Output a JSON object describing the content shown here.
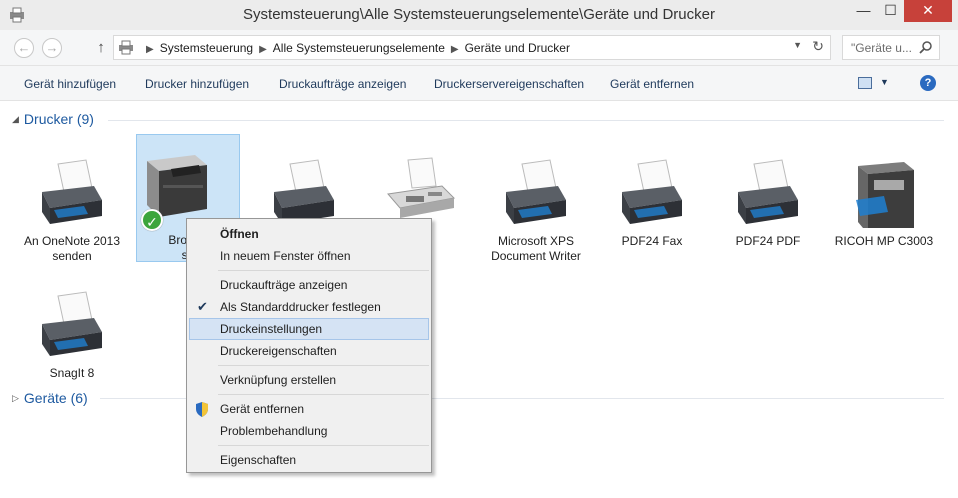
{
  "window": {
    "title": "Systemsteuerung\\Alle Systemsteuerungselemente\\Geräte und Drucker",
    "controls": {
      "minimize": "—",
      "maximize": "☐",
      "close": "✕"
    }
  },
  "address": {
    "breadcrumbs": [
      "Systemsteuerung",
      "Alle Systemsteuerungselemente",
      "Geräte und Drucker"
    ],
    "search_placeholder": "\"Geräte u..."
  },
  "commands": [
    "Gerät hinzufügen",
    "Drucker hinzufügen",
    "Druckaufträge anzeigen",
    "Druckerservereigenschaften",
    "Gerät entfernen"
  ],
  "groups": {
    "printers": {
      "header": "Drucker (9)"
    },
    "devices": {
      "header": "Geräte (6)"
    }
  },
  "printers": [
    {
      "label": "An OneNote 2013 senden",
      "icon": "printer-icon"
    },
    {
      "label": "Brother HL-5340D series",
      "icon": "laser-printer-icon",
      "default": true
    },
    {
      "label": "",
      "icon": "printer-icon"
    },
    {
      "label": "",
      "icon": "fax-icon"
    },
    {
      "label": "Microsoft XPS Document Writer",
      "icon": "printer-icon"
    },
    {
      "label": "PDF24 Fax",
      "icon": "printer-icon"
    },
    {
      "label": "PDF24 PDF",
      "icon": "printer-icon"
    },
    {
      "label": "RICOH MP C3003",
      "icon": "multifunction-printer-icon"
    },
    {
      "label": "SnagIt 8",
      "icon": "printer-icon"
    }
  ],
  "visible_labels": {
    "brother_line1": "Brother",
    "brother_line2": "se"
  },
  "context_menu": {
    "open": "Öffnen",
    "open_new_window": "In neuem Fenster öffnen",
    "show_jobs": "Druckaufträge anzeigen",
    "set_default": "Als Standarddrucker festlegen",
    "print_settings": "Druckeinstellungen",
    "printer_properties": "Druckereigenschaften",
    "create_shortcut": "Verknüpfung erstellen",
    "remove_device": "Gerät entfernen",
    "troubleshoot": "Problembehandlung",
    "properties": "Eigenschaften"
  },
  "colors": {
    "accent": "#1e5aa0",
    "selection": "#cce4f7",
    "menu_hover": "#d5e3f4",
    "close": "#c7413a"
  }
}
